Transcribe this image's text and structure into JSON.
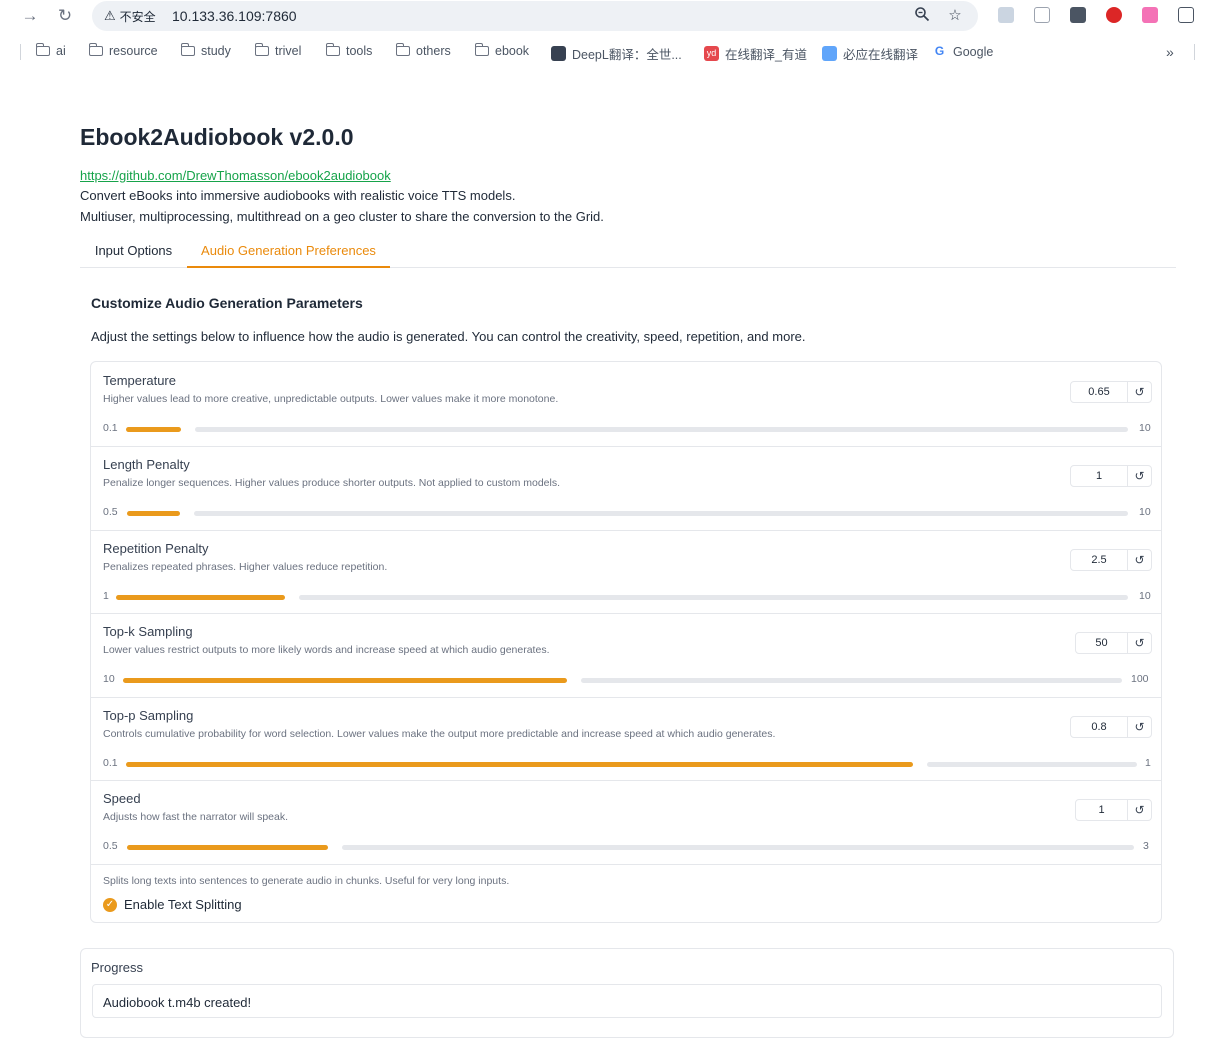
{
  "browser": {
    "security_label": "不安全",
    "url": "10.133.36.109:7860",
    "bookmarks": [
      {
        "label": "ai",
        "type": "folder"
      },
      {
        "label": "resource",
        "type": "folder"
      },
      {
        "label": "study",
        "type": "folder"
      },
      {
        "label": "trivel",
        "type": "folder"
      },
      {
        "label": "tools",
        "type": "folder"
      },
      {
        "label": "others",
        "type": "folder"
      },
      {
        "label": "ebook",
        "type": "folder"
      },
      {
        "label": "DeepL翻译：全世...",
        "type": "site"
      },
      {
        "label": "在线翻译_有道",
        "type": "site",
        "badge": "yd"
      },
      {
        "label": "必应在线翻译",
        "type": "site"
      },
      {
        "label": "Google",
        "type": "site",
        "badge": "G"
      }
    ],
    "overflow_label": "»"
  },
  "page": {
    "title": "Ebook2Audiobook v2.0.0",
    "repo_link": "https://github.com/DrewThomasson/ebook2audiobook",
    "description_1": "Convert eBooks into immersive audiobooks with realistic voice TTS models.",
    "description_2": "Multiuser, multiprocessing, multithread on a geo cluster to share the conversion to the Grid."
  },
  "tabs": [
    {
      "label": "Input Options",
      "active": false
    },
    {
      "label": "Audio Generation Preferences",
      "active": true
    }
  ],
  "section": {
    "title": "Customize Audio Generation Parameters",
    "description": "Adjust the settings below to influence how the audio is generated. You can control the creativity, speed, repetition, and more."
  },
  "params": [
    {
      "label": "Temperature",
      "info": "Higher values lead to more creative, unpredictable outputs. Lower values make it more monotone.",
      "value": "0.65",
      "min": "0.1",
      "max": "10",
      "fill_fraction": 0.055
    },
    {
      "label": "Length Penalty",
      "info": "Penalize longer sequences. Higher values produce shorter outputs. Not applied to custom models.",
      "value": "1",
      "min": "0.5",
      "max": "10",
      "fill_fraction": 0.053
    },
    {
      "label": "Repetition Penalty",
      "info": "Penalizes repeated phrases. Higher values reduce repetition.",
      "value": "2.5",
      "min": "1",
      "max": "10",
      "fill_fraction": 0.167
    },
    {
      "label": "Top-k Sampling",
      "info": "Lower values restrict outputs to more likely words and increase speed at which audio generates.",
      "value": "50",
      "min": "10",
      "max": "100",
      "fill_fraction": 0.444
    },
    {
      "label": "Top-p Sampling",
      "info": "Controls cumulative probability for word selection. Lower values make the output more predictable and increase speed at which audio generates.",
      "value": "0.8",
      "min": "0.1",
      "max": "1",
      "fill_fraction": 0.778
    },
    {
      "label": "Speed",
      "info": "Adjusts how fast the narrator will speak.",
      "value": "1",
      "min": "0.5",
      "max": "3",
      "fill_fraction": 0.2
    }
  ],
  "text_splitting": {
    "info": "Splits long texts into sentences to generate audio in chunks. Useful for very long inputs.",
    "label": "Enable Text Splitting",
    "checked": true
  },
  "progress": {
    "label": "Progress",
    "value": "Audiobook t.m4b created!"
  },
  "colors": {
    "accent": "#ea9a1c",
    "link": "#16a34a",
    "track": "#e5e7eb"
  }
}
